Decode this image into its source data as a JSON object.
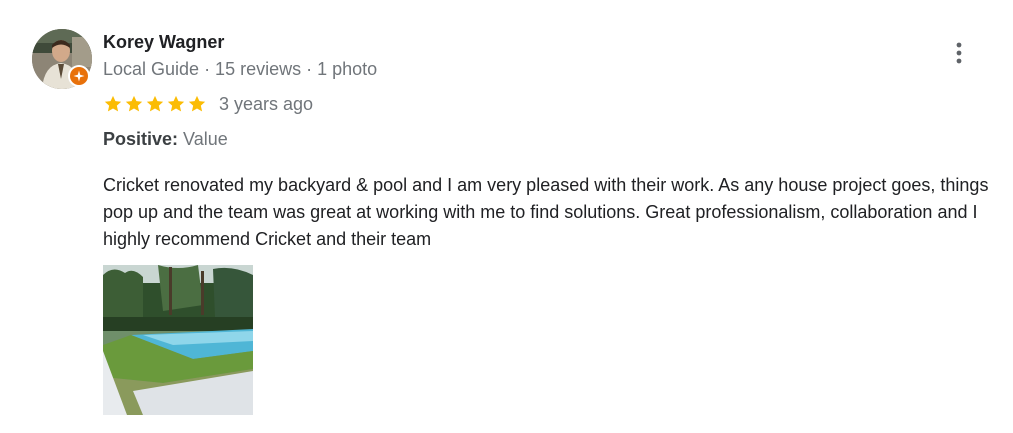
{
  "review": {
    "author_name": "Korey Wagner",
    "author_meta": "Local Guide · 15 reviews · 1 photo",
    "rating": 5,
    "rating_max": 5,
    "date": "3 years ago",
    "attribute_label": "Positive:",
    "attribute_value": "Value",
    "text": "Cricket renovated my backyard & pool and I am very pleased with their work. As any house project goes, things pop up and the team was great at working with me to find solutions. Great professionalism, collaboration and I highly recommend Cricket and their team"
  },
  "icons": {
    "avatar": "user-avatar",
    "badge": "local-guide-badge-icon",
    "more": "more-vertical-icon",
    "star": "star-icon"
  },
  "colors": {
    "star": "#fbbc04",
    "badge": "#e8710a",
    "meta_text": "#70757a",
    "body_text": "#202124"
  }
}
